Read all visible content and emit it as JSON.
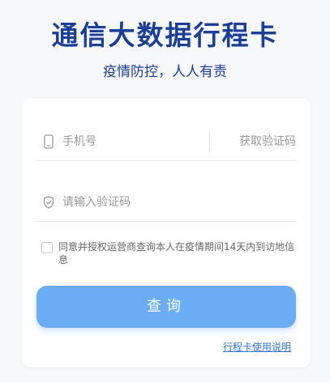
{
  "header": {
    "title": "通信大数据行程卡",
    "subtitle": "疫情防控，人人有责"
  },
  "form": {
    "phone_placeholder": "手机号",
    "get_code_label": "获取验证码",
    "code_placeholder": "请输入验证码",
    "agreement_text": "同意并授权运营商查询本人在疫情期间14天内到访地信息",
    "agreement_checked": false,
    "submit_label": "查询",
    "help_link": "行程卡使用说明"
  },
  "icons": {
    "phone": "mobile-phone-icon",
    "code": "shield-check-icon"
  },
  "colors": {
    "brand": "#1b3e96",
    "button": "#6aadf5",
    "link": "#2e76d8",
    "placeholder": "#999999"
  }
}
